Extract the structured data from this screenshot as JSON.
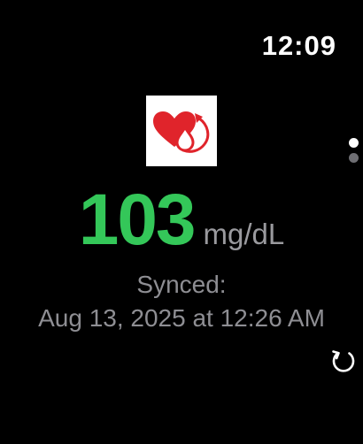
{
  "status_bar": {
    "time": "12:09"
  },
  "app_icon": {
    "icon_name": "heart-drop-cycle-icon",
    "color": "#e0242b"
  },
  "page_indicator": {
    "pages": 2,
    "current": 1,
    "active_color": "#ffffff",
    "inactive_color": "#6e6e73"
  },
  "glucose": {
    "value": "103",
    "unit": "mg/dL",
    "value_color": "#34c759"
  },
  "sync": {
    "label": "Synced:",
    "timestamp": "Aug 13, 2025 at 12:26 AM"
  },
  "actions": {
    "refresh_icon": "refresh-icon"
  }
}
